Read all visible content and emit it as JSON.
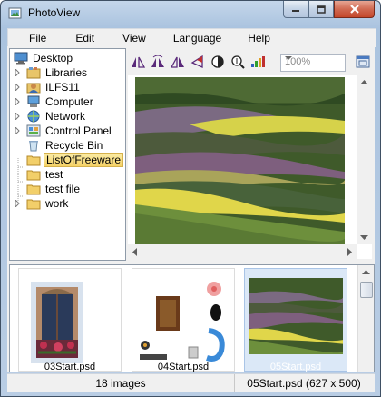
{
  "window": {
    "title": "PhotoView"
  },
  "menu": [
    "File",
    "Edit",
    "View",
    "Language",
    "Help"
  ],
  "tree": [
    {
      "label": "Desktop",
      "icon": "desktop-icon",
      "expandable": false,
      "selected": false
    },
    {
      "label": "Libraries",
      "icon": "libraries-icon",
      "expandable": true,
      "selected": false
    },
    {
      "label": "ILFS11",
      "icon": "user-icon",
      "expandable": true,
      "selected": false
    },
    {
      "label": "Computer",
      "icon": "computer-icon",
      "expandable": true,
      "selected": false
    },
    {
      "label": "Network",
      "icon": "network-icon",
      "expandable": true,
      "selected": false
    },
    {
      "label": "Control Panel",
      "icon": "control-panel-icon",
      "expandable": true,
      "selected": false
    },
    {
      "label": "Recycle Bin",
      "icon": "recycle-bin-icon",
      "expandable": false,
      "selected": false
    },
    {
      "label": "ListOfFreeware",
      "icon": "folder-icon",
      "expandable": false,
      "selected": true
    },
    {
      "label": "test",
      "icon": "folder-icon",
      "expandable": false,
      "selected": false
    },
    {
      "label": "test file",
      "icon": "folder-icon",
      "expandable": false,
      "selected": false
    },
    {
      "label": "work",
      "icon": "folder-icon",
      "expandable": true,
      "selected": false
    }
  ],
  "toolbar": {
    "buttons": [
      "flip-vertical-icon",
      "rotate-icon",
      "mirror-icon",
      "sharpen-icon",
      "contrast-icon",
      "zoom-icon",
      "levels-icon"
    ],
    "zoom_value": "100%",
    "fit_button": "fit-window-icon"
  },
  "thumbnails": [
    {
      "label": "03Start.psd",
      "selected": false
    },
    {
      "label": "04Start.psd",
      "selected": false
    },
    {
      "label": "05Start.psd",
      "selected": true
    }
  ],
  "status": {
    "count": "18 images",
    "current": "05Start.psd (627 x 500)"
  },
  "colors": {
    "selection": "#f5d267",
    "title_bar": "#aac3df",
    "close_button": "#c4472a"
  }
}
